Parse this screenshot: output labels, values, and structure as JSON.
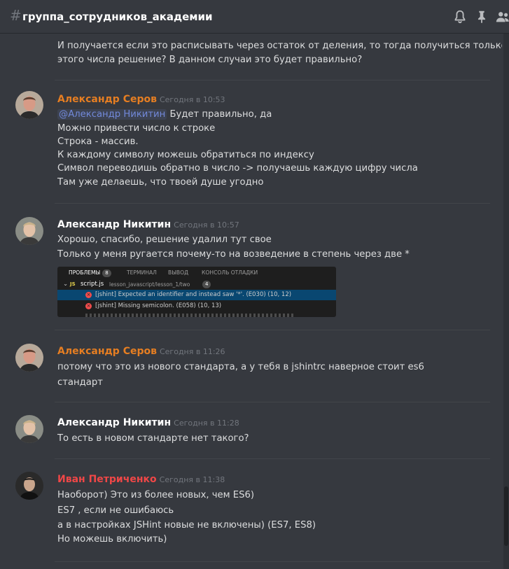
{
  "header": {
    "hash": "#",
    "title": "группа_сотрудников_академии"
  },
  "messages": {
    "m0": {
      "lines": [
        "И получается если это расписывать через остаток от деления, то тогда получиться только для",
        "этого числа решение? В данном случаи это будет правильно?"
      ]
    },
    "m1": {
      "author": "Александр Серов",
      "author_color": "#e67e22",
      "time": "Сегодня в 10:53",
      "mention": "@Александр Никитин",
      "first_line_rest": " Будет правильно, да",
      "lines": [
        "Можно привести число к строке",
        "Строка - массив.",
        "К каждому символу можешь обратиться по индексу",
        "Символ переводишь обратно в число -> получаешь каждую цифру числа",
        "Там уже делаешь, что твоей душе угодно"
      ]
    },
    "m2": {
      "author": "Александр Никитин",
      "author_color": "#ffffff",
      "time": "Сегодня в 10:57",
      "lines": [
        "Хорошо, спасибо, решение удалил тут свое",
        "Только у меня ругается почему-то на возведение в степень через две *"
      ],
      "attachment": {
        "tabs": [
          "ПРОБЛЕМЫ",
          "ТЕРМИНАЛ",
          "ВЫВОД",
          "КОНСОЛЬ ОТЛАДКИ"
        ],
        "problems_count": "8",
        "file_lang": "JS",
        "file_name": "script.js",
        "file_path": "lesson_javascript/lesson_1/two",
        "file_count": "4",
        "rows": [
          "[jshint] Expected an identifier and instead saw '*'. (E030)  (10, 12)",
          "[jshint] Missing semicolon. (E058)  (10, 13)"
        ]
      }
    },
    "m3": {
      "author": "Александр Серов",
      "author_color": "#e67e22",
      "time": "Сегодня в 11:26",
      "lines": [
        "потому что это из нового стандарта, а у тебя в jshintrc наверное стоит es6",
        "стандарт"
      ]
    },
    "m4": {
      "author": "Александр Никитин",
      "author_color": "#ffffff",
      "time": "Сегодня в 11:28",
      "lines": [
        "То есть в новом стандарте нет такого?"
      ]
    },
    "m5": {
      "author": "Иван Петриченко",
      "author_color": "#f04747",
      "time": "Сегодня в 11:38",
      "lines": [
        "Наоборот) Это из более новых, чем ES6)",
        "ES7 , если не ошибаюсь",
        "а в настройках JSHint новые не включены) (ES7, ES8)",
        "Но можешь включить)"
      ]
    }
  },
  "colors": {
    "background": "#36393f",
    "text": "#dcddde",
    "timestamp": "#72767d",
    "mention": "#7289da"
  },
  "icons": [
    "channel-hash-icon",
    "bell-icon",
    "pin-icon",
    "members-icon"
  ]
}
